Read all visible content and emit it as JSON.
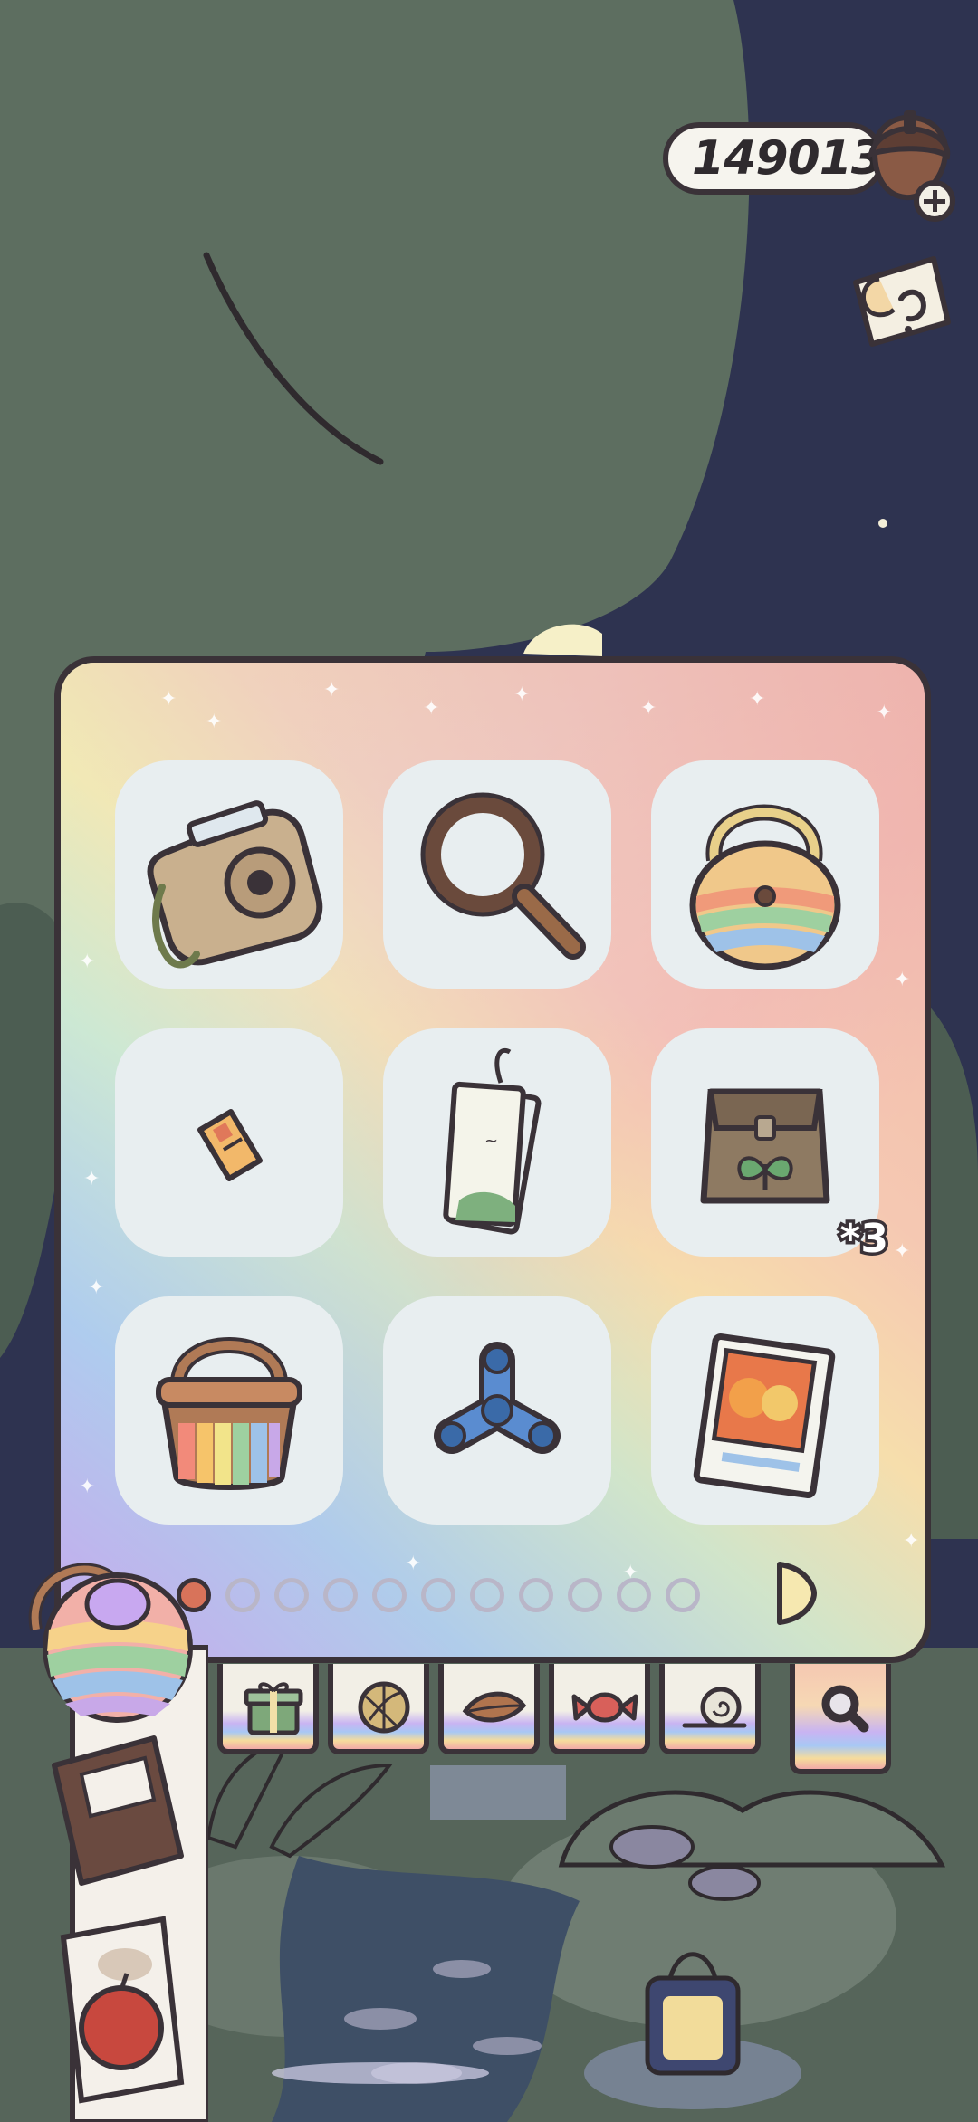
{
  "currency": {
    "amount": "149013",
    "icon": "acorn-icon"
  },
  "hint": {
    "icon": "hint-scroll-icon"
  },
  "inventory": {
    "items": [
      {
        "name": "instant-camera",
        "count": ""
      },
      {
        "name": "magnifying-glass",
        "count": ""
      },
      {
        "name": "rainbow-fluffy-bag",
        "count": ""
      },
      {
        "name": "ticket",
        "count": ""
      },
      {
        "name": "bookmark-tag",
        "count": ""
      },
      {
        "name": "seed-bag",
        "count": "*3"
      },
      {
        "name": "rainbow-bucket",
        "count": ""
      },
      {
        "name": "fidget-spinner",
        "count": ""
      },
      {
        "name": "photo-card",
        "count": ""
      }
    ],
    "page_count": 11,
    "current_page": 1
  },
  "tabs": [
    {
      "name": "gift-tab",
      "icon": "gift-icon"
    },
    {
      "name": "yarn-tab",
      "icon": "yarn-ball-icon"
    },
    {
      "name": "leaf-tab",
      "icon": "leaf-icon"
    },
    {
      "name": "candy-tab",
      "icon": "candy-icon"
    },
    {
      "name": "snail-tab",
      "icon": "snail-icon"
    },
    {
      "name": "search-tab",
      "icon": "magnifier-icon",
      "active": true
    }
  ],
  "colors": {
    "outline": "#3a3238",
    "slot_bg": "#e8eef0",
    "active_dot": "#d8735a",
    "night_sky": "#2e3350",
    "tree_green": "#5d6e60"
  }
}
